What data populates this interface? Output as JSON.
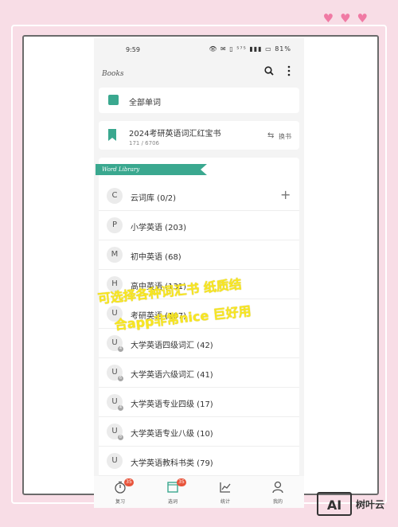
{
  "decor": {
    "hearts": [
      "♥",
      "♥",
      "♥"
    ]
  },
  "status_bar": {
    "time": "9:59",
    "icons_text": "👁 ✉ ▯ ⁵⁷⁵ ▮▮▮ ▭ 81%"
  },
  "header": {
    "title": "Books"
  },
  "all_words": {
    "label": "全部单词"
  },
  "current_book": {
    "name": "2024考研英语词汇红宝书",
    "progress": "171 / 6706",
    "switch_icon": "⇆",
    "switch_label": "换书"
  },
  "library": {
    "section_title": "Word Library",
    "rows": [
      {
        "letter": "C",
        "sub": "",
        "label": "云词库 (0/2)",
        "action": "+"
      },
      {
        "letter": "P",
        "sub": "",
        "label": "小学英语 (203)",
        "action": ""
      },
      {
        "letter": "M",
        "sub": "",
        "label": "初中英语 (68)",
        "action": ""
      },
      {
        "letter": "H",
        "sub": "",
        "label": "高中英语 (131)",
        "action": ""
      },
      {
        "letter": "U",
        "sub": "",
        "label": "考研英语 (107)",
        "action": ""
      },
      {
        "letter": "U",
        "sub": "4",
        "label": "大学英语四级词汇 (42)",
        "action": ""
      },
      {
        "letter": "U",
        "sub": "6",
        "label": "大学英语六级词汇 (41)",
        "action": ""
      },
      {
        "letter": "U",
        "sub": "4",
        "label": "大学英语专业四级 (17)",
        "action": ""
      },
      {
        "letter": "U",
        "sub": "8",
        "label": "大学英语专业八级 (10)",
        "action": ""
      },
      {
        "letter": "U",
        "sub": "",
        "label": "大学英语教科书类 (79)",
        "action": ""
      }
    ]
  },
  "tabs": [
    {
      "label": "复习",
      "badge": "35"
    },
    {
      "label": "选词",
      "badge": "35"
    },
    {
      "label": "统计",
      "badge": ""
    },
    {
      "label": "我的",
      "badge": ""
    }
  ],
  "overlay": {
    "line1": "可选择各种词汇书 纸质结",
    "line2": "合app非常nice 巨好用"
  },
  "watermark": {
    "logo": "AI",
    "text": "树叶云"
  },
  "colors": {
    "accent": "#3aa88f",
    "badge": "#e8543b",
    "overlay": "#f8e620",
    "background": "#f8dde6"
  }
}
